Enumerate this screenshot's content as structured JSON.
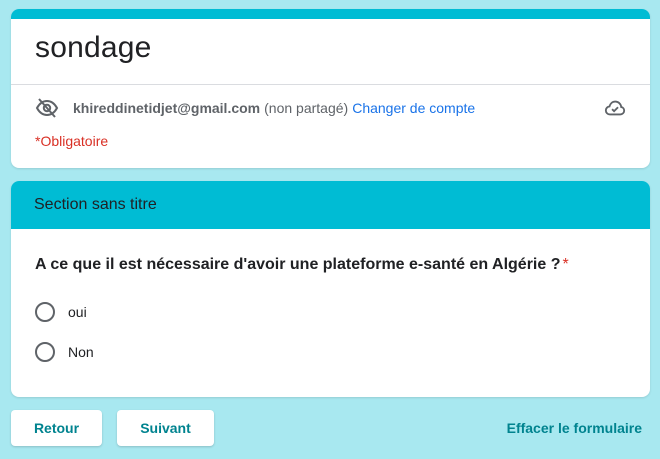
{
  "form": {
    "title": "sondage",
    "account": {
      "email": "khireddinetidjet@gmail.com",
      "note": "(non partagé)",
      "switch_label": "Changer de compte",
      "icons": [
        "eye-off-icon",
        "cloud-done-icon"
      ]
    },
    "required_note": "*Obligatoire"
  },
  "section": {
    "title": "Section sans titre",
    "question": {
      "text": "A ce que il est nécessaire d'avoir une plateforme e-santé en Algérie  ?",
      "required_mark": "*",
      "options": [
        {
          "label": "oui",
          "selected": false
        },
        {
          "label": "Non",
          "selected": false
        }
      ]
    }
  },
  "navigation": {
    "back_label": "Retour",
    "next_label": "Suivant",
    "clear_label": "Effacer le formulaire"
  },
  "colors": {
    "background": "#a8e8f0",
    "accent": "#00bcd4",
    "link": "#1a73e8",
    "button_text": "#00838f",
    "required": "#d93025"
  }
}
